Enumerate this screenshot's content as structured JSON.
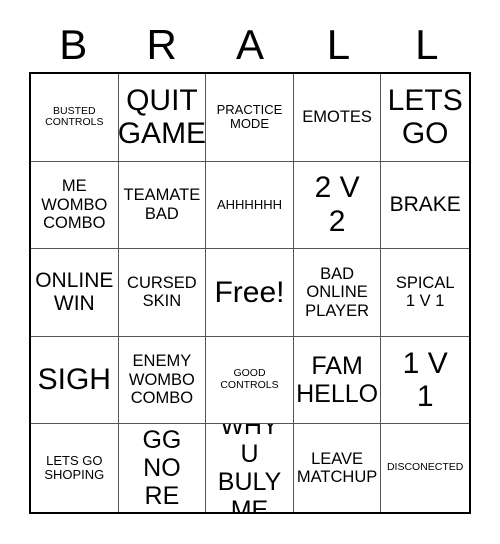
{
  "card": {
    "header_letters": [
      "B",
      "R",
      "A",
      "L",
      "L"
    ],
    "free_space_label": "Free!",
    "rows": [
      [
        {
          "text": "BUSTED\nCONTROLS",
          "size": "xs"
        },
        {
          "text": "QUIT\nGAME",
          "size": "xxl"
        },
        {
          "text": "PRACTICE\nMODE",
          "size": "sm"
        },
        {
          "text": "EMOTES",
          "size": "md"
        },
        {
          "text": "LETS\nGO",
          "size": "xxl"
        }
      ],
      [
        {
          "text": "ME\nWOMBO\nCOMBO",
          "size": "md"
        },
        {
          "text": "TEAMATE\nBAD",
          "size": "md"
        },
        {
          "text": "AHHHHHH",
          "size": "sm"
        },
        {
          "text": "2 V\n2",
          "size": "xxl"
        },
        {
          "text": "BRAKE",
          "size": "lg"
        }
      ],
      [
        {
          "text": "ONLINE\nWIN",
          "size": "lg"
        },
        {
          "text": "CURSED\nSKIN",
          "size": "md"
        },
        {
          "text": "Free!",
          "size": "xxl"
        },
        {
          "text": "BAD\nONLINE\nPLAYER",
          "size": "md"
        },
        {
          "text": "SPICAL\n1 V 1",
          "size": "md"
        }
      ],
      [
        {
          "text": "SIGH",
          "size": "xxl"
        },
        {
          "text": "ENEMY\nWOMBO\nCOMBO",
          "size": "md"
        },
        {
          "text": "GOOD\nCONTROLS",
          "size": "xs"
        },
        {
          "text": "FAM\nHELLO",
          "size": "xl"
        },
        {
          "text": "1 V\n1",
          "size": "xxl"
        }
      ],
      [
        {
          "text": "LETS GO\nSHOPING",
          "size": "sm"
        },
        {
          "text": "GG NO\nRE",
          "size": "xl"
        },
        {
          "text": "WHY U\nBULY\nME",
          "size": "xl"
        },
        {
          "text": "LEAVE\nMATCHUP",
          "size": "md"
        },
        {
          "text": "DISCONECTED",
          "size": "xs"
        }
      ]
    ]
  }
}
